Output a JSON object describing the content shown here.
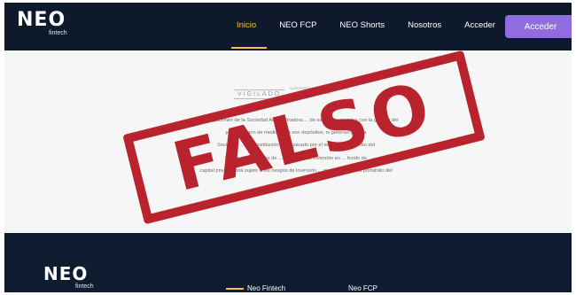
{
  "header": {
    "logo": "NEO",
    "logo_sub": "fintech",
    "nav": [
      "Inicio",
      "NEO FCP",
      "NEO Shorts",
      "Nosotros",
      "Acceder"
    ],
    "active": "Inicio",
    "cta": "Acceder"
  },
  "content": {
    "vigilado": "VIGILADO",
    "vigilado_sub": "SUPERINTENDENCIA FINANCIERA DE COLOMBIA",
    "legal_lines": [
      "\"Las obligaciones de la Sociedad Administradora ... de esté, relacionadas con la gestión del",
      "portafolio son de medio ... no son depósitos, ni generan para la",
      "Sociedad ... de constitución ... amparado por el seguro de depósito del",
      "Fondo de Garantías de ... ningún ... La inversión en ... fondo de",
      "capital privado está sujeto a los riesgos de inversión ... que componen el portafolio del"
    ],
    "stamp": "FALSO"
  },
  "footer": {
    "logo": "NEO",
    "logo_sub": "fintech",
    "col1": "Neo Fintech",
    "col2": "Neo FCP"
  },
  "colors": {
    "navy": "#0e1a2b",
    "accent": "#f2c14b",
    "cta": "#8f6ddf",
    "stamp": "#b9232d"
  }
}
